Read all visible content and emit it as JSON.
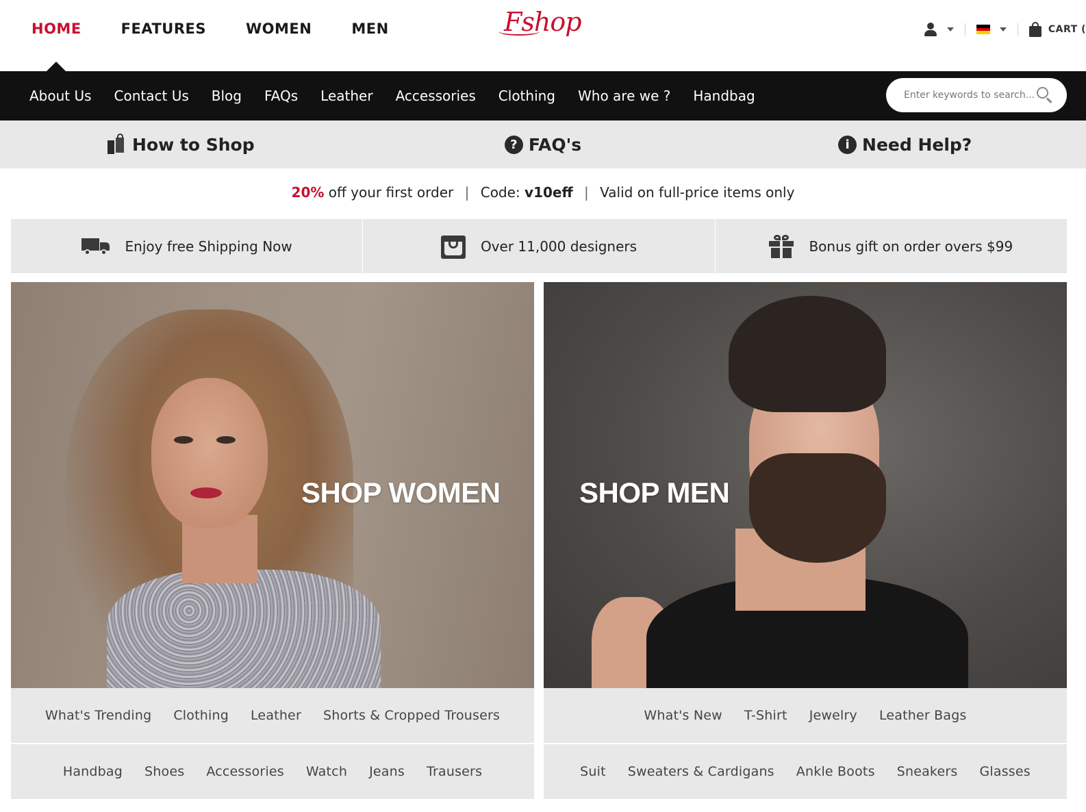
{
  "header": {
    "main_nav": [
      {
        "label": "HOME",
        "active": true
      },
      {
        "label": "FEATURES",
        "active": false
      },
      {
        "label": "WOMEN",
        "active": false
      },
      {
        "label": "MEN",
        "active": false
      }
    ],
    "logo_text": "Fshop",
    "cart_label": "CART (",
    "language_flag": "de",
    "icons": {
      "account": "user-icon",
      "language": "flag-icon",
      "cart": "shopping-bag-icon"
    }
  },
  "category_bar": {
    "links": [
      "About Us",
      "Contact Us",
      "Blog",
      "FAQs",
      "Leather",
      "Accessories",
      "Clothing",
      "Who are we ?",
      "Handbag"
    ],
    "search_placeholder": "Enter keywords to search..."
  },
  "help_bar": {
    "items": [
      {
        "label": "How to Shop",
        "icon": "shopping-bags-icon"
      },
      {
        "label": "FAQ's",
        "icon": "question-circle-icon"
      },
      {
        "label": "Need Help?",
        "icon": "info-circle-icon"
      }
    ]
  },
  "promo": {
    "percent": "20%",
    "text": "off your first order",
    "code_label": "Code:",
    "code": "v10eff",
    "validity": "Valid on full-price items only"
  },
  "features": [
    {
      "label": "Enjoy free Shipping Now",
      "icon": "truck-icon"
    },
    {
      "label": "Over 11,000 designers",
      "icon": "store-icon"
    },
    {
      "label": "Bonus gift on order overs $99",
      "icon": "gift-icon"
    }
  ],
  "hero": {
    "women": {
      "title": "SHOP WOMEN",
      "links_row1": [
        "What's Trending",
        "Clothing",
        "Leather",
        "Shorts & Cropped Trousers"
      ],
      "links_row2": [
        "Handbag",
        "Shoes",
        "Accessories",
        "Watch",
        "Jeans",
        "Trausers"
      ]
    },
    "men": {
      "title": "SHOP MEN",
      "links_row1": [
        "What's New",
        "T-Shirt",
        "Jewelry",
        "Leather Bags"
      ],
      "links_row2": [
        "Suit",
        "Sweaters & Cardigans",
        "Ankle Boots",
        "Sneakers",
        "Glasses"
      ]
    }
  },
  "colors": {
    "accent": "#c8102e",
    "dark_bar": "#111111",
    "light_strip": "#e8e8e8"
  }
}
